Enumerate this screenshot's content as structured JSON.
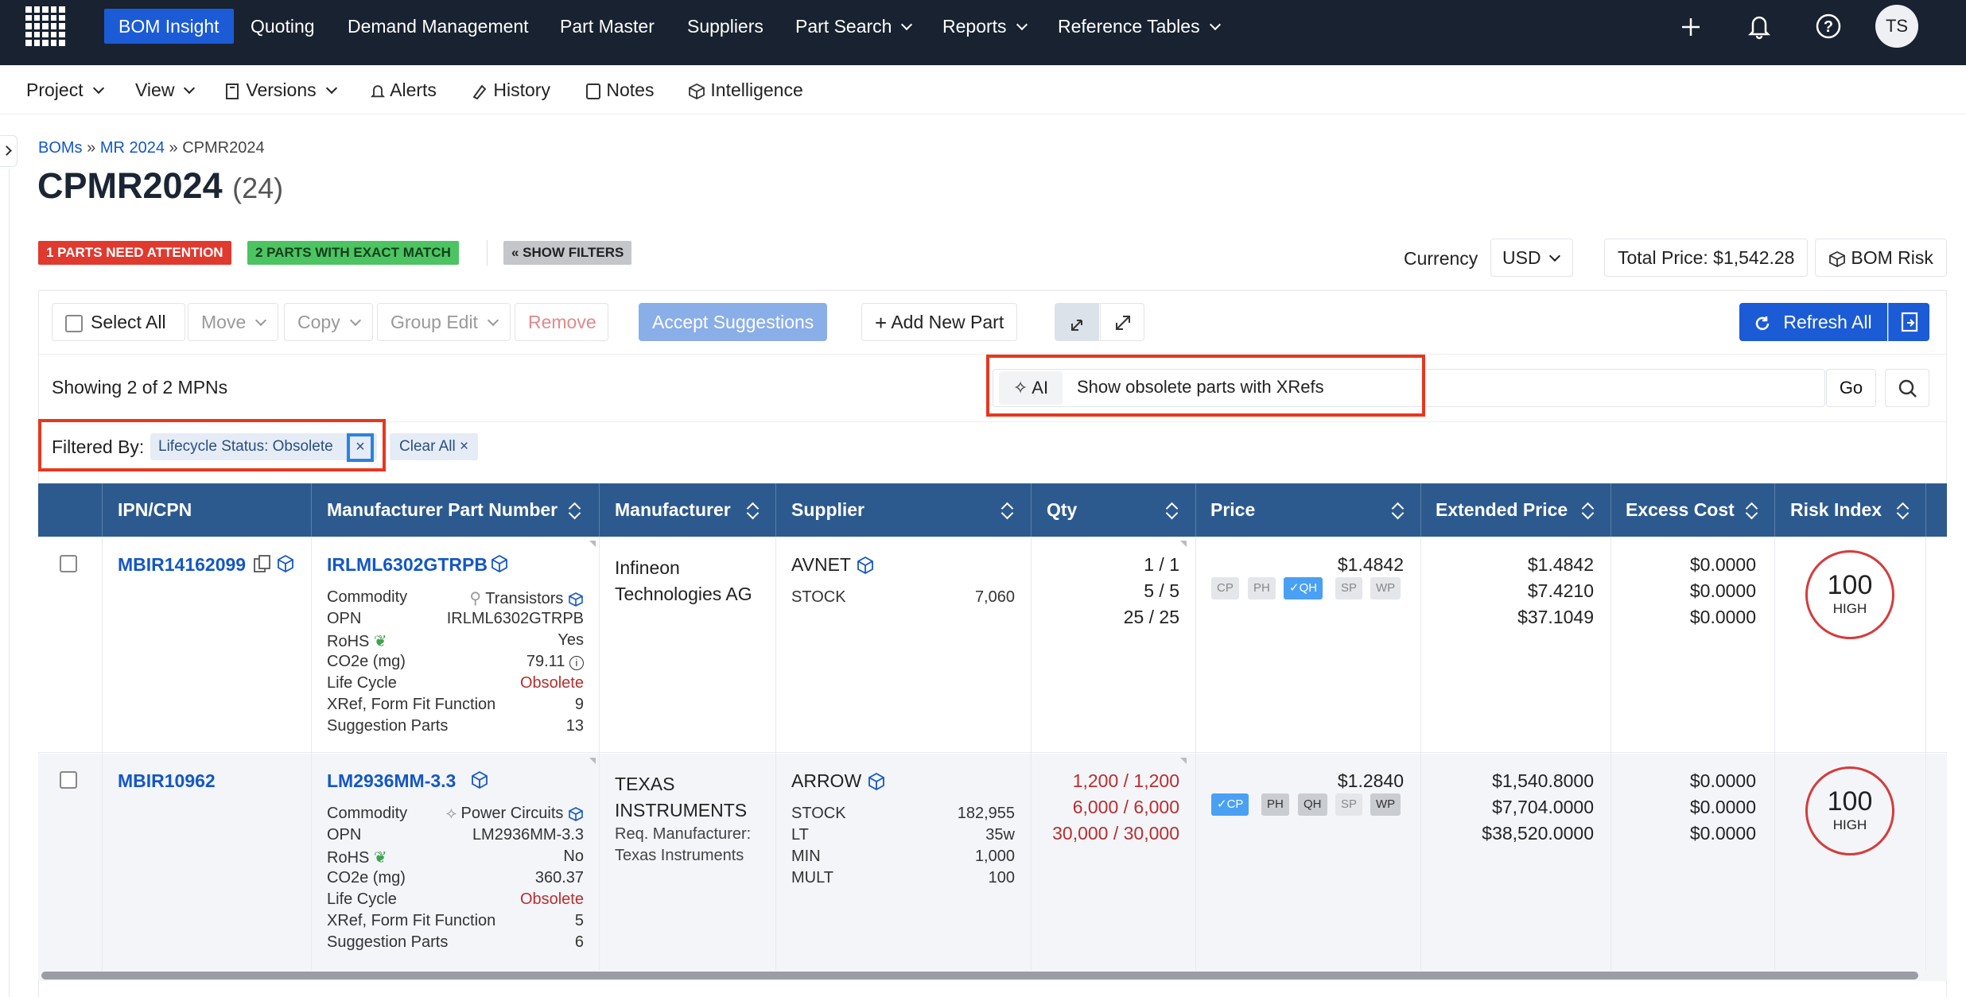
{
  "nav": {
    "items": [
      "BOM Insight",
      "Quoting",
      "Demand Management",
      "Part Master",
      "Suppliers",
      "Part Search",
      "Reports",
      "Reference Tables"
    ],
    "avatar": "TS"
  },
  "subnav": {
    "items": [
      "Project",
      "View",
      "Versions",
      "Alerts",
      "History",
      "Notes",
      "Intelligence"
    ]
  },
  "breadcrumb": {
    "a": "BOMs",
    "b": "MR 2024",
    "c": "CPMR2024",
    "sep": "»"
  },
  "title": {
    "name": "CPMR2024",
    "count": "(24)"
  },
  "badges": {
    "attention": "1 PARTS NEED ATTENTION",
    "exact": "2 PARTS WITH EXACT MATCH",
    "filters": "« SHOW FILTERS"
  },
  "currency": {
    "label": "Currency",
    "value": "USD",
    "total": "Total Price: $1,542.28",
    "risk": "BOM Risk"
  },
  "toolbar": {
    "select_all": "Select All",
    "move": "Move",
    "copy": "Copy",
    "group_edit": "Group Edit",
    "remove": "Remove",
    "accept": "Accept Suggestions",
    "add": "Add New Part",
    "refresh": "Refresh All"
  },
  "showing": "Showing 2 of 2 MPNs",
  "search": {
    "ai": "AI",
    "query": "Show obsolete parts with XRefs",
    "go": "Go"
  },
  "filter": {
    "label": "Filtered By:",
    "chip": "Lifecycle Status: Obsolete",
    "clear": "Clear All"
  },
  "columns": [
    "IPN/CPN",
    "Manufacturer Part Number",
    "Manufacturer",
    "Supplier",
    "Qty",
    "Price",
    "Extended Price",
    "Excess Cost",
    "Risk Index"
  ],
  "rows": [
    {
      "ipn": "MBIR14162099",
      "mpn": "IRLML6302GTRPB",
      "attrs": [
        [
          "Commodity",
          "Transistors"
        ],
        [
          "OPN",
          "IRLML6302GTRPB"
        ],
        [
          "RoHS",
          "Yes"
        ],
        [
          "CO2e (mg)",
          "79.11"
        ],
        [
          "Life Cycle",
          "Obsolete"
        ],
        [
          "XRef, Form Fit Function",
          "9"
        ],
        [
          "Suggestion Parts",
          "13"
        ]
      ],
      "mfr_line1": "Infineon",
      "mfr_line2": "Technologies AG",
      "req_label": "",
      "req_value": "",
      "supplier": "AVNET",
      "stock": [
        [
          "STOCK",
          "7,060"
        ]
      ],
      "qty": [
        "1 / 1",
        "5 / 5",
        "25 / 25"
      ],
      "price": "$1.4842",
      "pbtns": [
        "CP",
        "PH",
        "✓QH",
        "SP",
        "WP"
      ],
      "ext": [
        "$1.4842",
        "$7.4210",
        "$37.1049"
      ],
      "excess": [
        "$0.0000",
        "$0.0000",
        "$0.0000"
      ],
      "risk": "100",
      "risk_label": "HIGH"
    },
    {
      "ipn": "MBIR10962",
      "mpn": "LM2936MM-3.3",
      "attrs": [
        [
          "Commodity",
          "Power Circuits"
        ],
        [
          "OPN",
          "LM2936MM-3.3"
        ],
        [
          "RoHS",
          "No"
        ],
        [
          "CO2e (mg)",
          "360.37"
        ],
        [
          "Life Cycle",
          "Obsolete"
        ],
        [
          "XRef, Form Fit Function",
          "5"
        ],
        [
          "Suggestion Parts",
          "6"
        ]
      ],
      "mfr_line1": "TEXAS",
      "mfr_line2": "INSTRUMENTS",
      "req_label": "Req. Manufacturer:",
      "req_value": "Texas Instruments",
      "supplier": "ARROW",
      "stock": [
        [
          "STOCK",
          "182,955"
        ],
        [
          "LT",
          "35w"
        ],
        [
          "MIN",
          "1,000"
        ],
        [
          "MULT",
          "100"
        ]
      ],
      "qty": [
        "1,200 / 1,200",
        "6,000 / 6,000",
        "30,000 / 30,000"
      ],
      "price": "$1.2840",
      "pbtns": [
        "✓CP",
        "PH",
        "QH",
        "SP",
        "WP"
      ],
      "ext": [
        "$1,540.8000",
        "$7,704.0000",
        "$38,520.0000"
      ],
      "excess": [
        "$0.0000",
        "$0.0000",
        "$0.0000"
      ],
      "risk": "100",
      "risk_label": "HIGH"
    }
  ],
  "colors": {
    "nav": "#182230",
    "active": "#1c5bd6",
    "header": "#2d5a8e",
    "attention": "#e03a2f",
    "exact": "#3fbf57",
    "obsolete": "#b92e2e",
    "highlight": "#e8371e"
  }
}
